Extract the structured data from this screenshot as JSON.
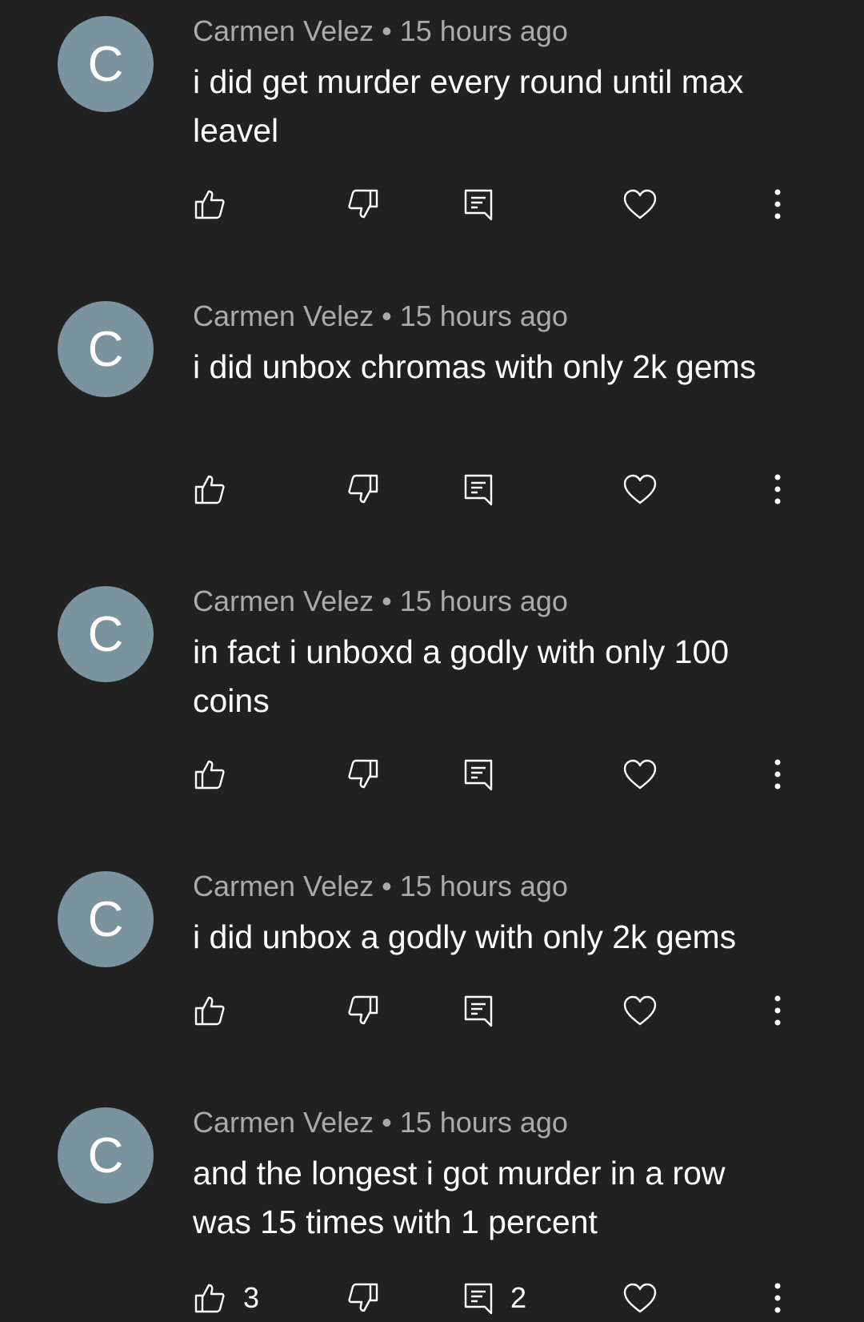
{
  "comments": [
    {
      "avatar_letter": "C",
      "author": "Carmen Velez",
      "separator": "•",
      "time": "15 hours ago",
      "text": "i did get murder every round until max leavel",
      "likes": "",
      "replies": ""
    },
    {
      "avatar_letter": "C",
      "author": "Carmen Velez",
      "separator": "•",
      "time": "15 hours ago",
      "text": "i did unbox chromas with only 2k gems",
      "likes": "",
      "replies": ""
    },
    {
      "avatar_letter": "C",
      "author": "Carmen Velez",
      "separator": "•",
      "time": "15 hours ago",
      "text": "in fact i unboxd a godly with only 100 coins",
      "likes": "",
      "replies": ""
    },
    {
      "avatar_letter": "C",
      "author": "Carmen Velez",
      "separator": "•",
      "time": "15 hours ago",
      "text": "i did unbox a godly with only 2k gems",
      "likes": "",
      "replies": ""
    },
    {
      "avatar_letter": "C",
      "author": "Carmen Velez",
      "separator": "•",
      "time": "15 hours ago",
      "text": "and the longest i got murder in a row was 15 times with 1 percent",
      "likes": "3",
      "replies": "2"
    }
  ],
  "icons": {
    "like": "thumb-up-icon",
    "dislike": "thumb-down-icon",
    "reply": "reply-comment-icon",
    "heart": "heart-icon",
    "more": "more-vertical-icon"
  },
  "colors": {
    "background": "#212121",
    "avatar": "#7a939f",
    "meta_text": "#aaaaaa",
    "body_text": "#ffffff"
  }
}
